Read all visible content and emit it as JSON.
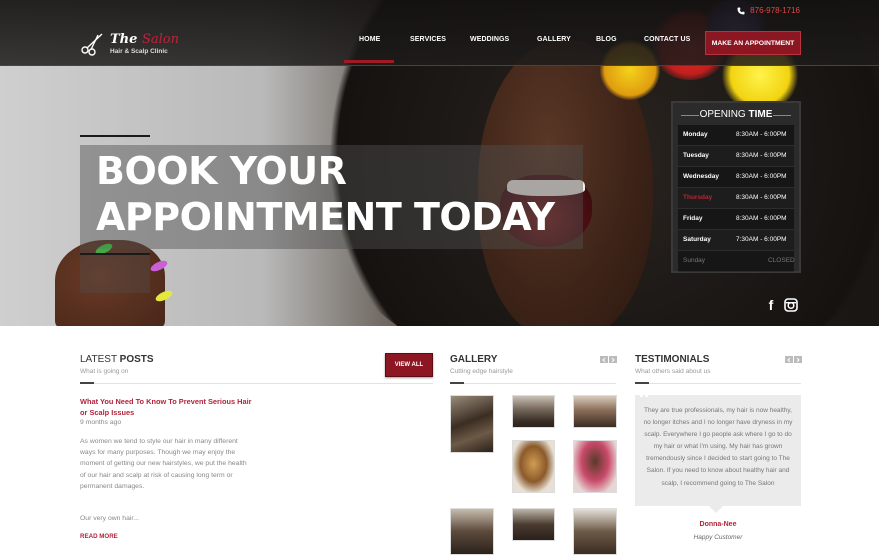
{
  "header": {
    "phone": "876-978-1716",
    "brand_main": "The ",
    "brand_accent": "Salon",
    "brand_tagline": "Hair & Scalp Clinic",
    "nav": [
      "HOME",
      "SERVICES",
      "WEDDINGS",
      "GALLERY",
      "BLOG",
      "CONTACT US"
    ],
    "appointment_button": "MAKE AN APPOINTMENT"
  },
  "hero": {
    "headline_line1": "BOOK YOUR",
    "headline_line2": "APPOINTMENT TODAY"
  },
  "opening_time": {
    "title_light": "OPENING ",
    "title_bold": "TIME",
    "rows": [
      {
        "day": "Monday",
        "time": "8:30AM - 6:00PM"
      },
      {
        "day": "Tuesday",
        "time": "8:30AM - 6:00PM"
      },
      {
        "day": "Wednesday",
        "time": "8:30AM - 6:00PM"
      },
      {
        "day": "Thursday",
        "time": "8:30AM - 6:00PM"
      },
      {
        "day": "Friday",
        "time": "8:30AM - 6:00PM"
      },
      {
        "day": "Saturday",
        "time": "7:30AM - 6:00PM"
      },
      {
        "day": "Sunday",
        "time": "CLOSED"
      }
    ]
  },
  "social": {
    "facebook": "f",
    "instagram": "instagram-icon"
  },
  "latest_posts": {
    "title_light": "LATEST ",
    "title_bold": "POSTS",
    "subtitle": "What is going on",
    "view_all": "VIEW ALL",
    "post_title": "What You Need To Know To Prevent Serious Hair or Scalp Issues",
    "post_date": "9 months ago",
    "post_body": "As women we tend to style our hair in many different ways for many purposes. Though we may enjoy the moment of getting our new hairstyles, we put the health of our hair and scalp at risk of causing long term or permanent damages.",
    "post_extra": "Our very own hair...",
    "read_more": "READ MORE"
  },
  "gallery": {
    "title": "GALLERY",
    "subtitle": "Cutting edge hairstyle"
  },
  "testimonials": {
    "title": "TESTIMONIALS",
    "subtitle": "What others said about us",
    "text": "They are true professionals, my hair is now healthy, no longer itches and I no longer have dryness in my scalp. Everywhere I go people ask where I go to do my hair or what I'm using. My hair has grown tremendously since I decided to start going to The Salon. If you need to know about healthy hair and scalp, I recommend going to The Salon",
    "name": "Donna-Nee",
    "role": "Happy Customer"
  },
  "colors": {
    "accent": "#8c1621",
    "link": "#b3233a",
    "phone": "#e04848"
  }
}
